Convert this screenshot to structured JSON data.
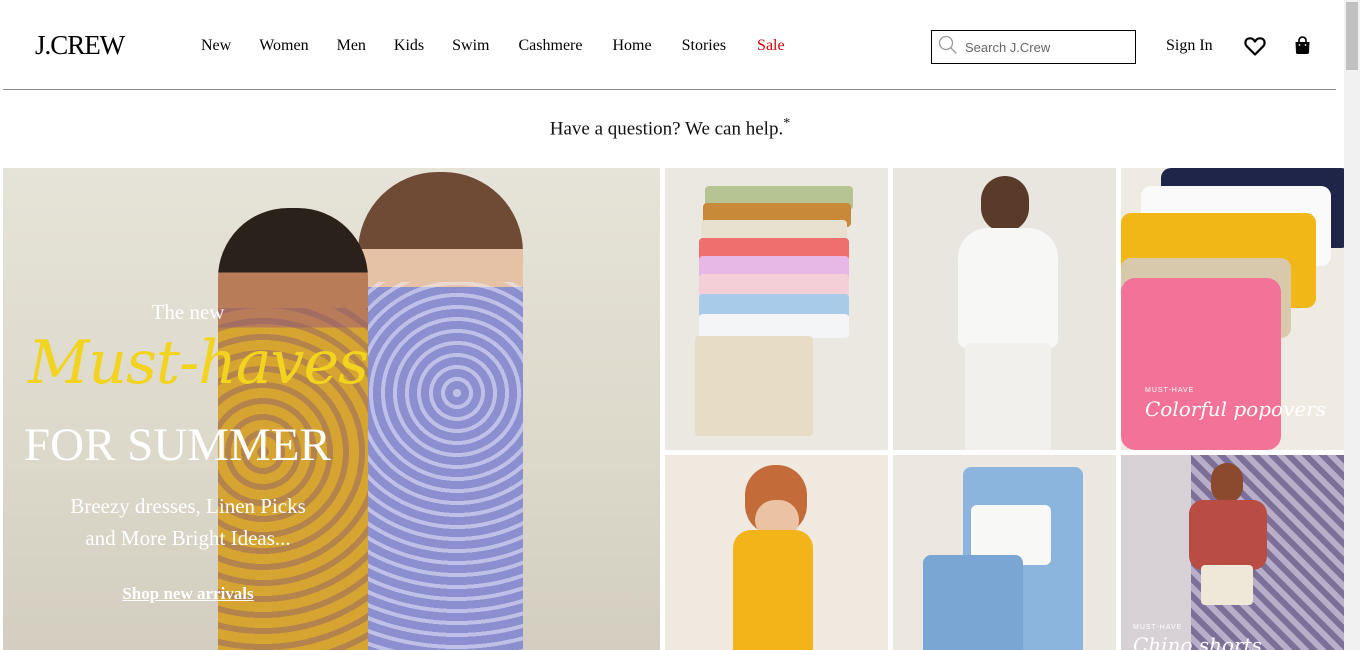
{
  "header": {
    "logo": "J.CREW",
    "nav": [
      {
        "label": "New",
        "color": "#000000"
      },
      {
        "label": "Women",
        "color": "#000000"
      },
      {
        "label": "Men",
        "color": "#000000"
      },
      {
        "label": "Kids",
        "color": "#000000"
      },
      {
        "label": "Swim",
        "color": "#000000"
      },
      {
        "label": "Cashmere",
        "color": "#000000"
      },
      {
        "label": "Home",
        "color": "#000000"
      },
      {
        "label": "Stories",
        "color": "#000000"
      },
      {
        "label": "Sale",
        "color": "#d50000"
      }
    ],
    "search_placeholder": "Search J.Crew",
    "sign_in": "Sign In",
    "icons": [
      "search-icon",
      "heart-icon",
      "bag-icon"
    ]
  },
  "promo": {
    "text": "Have a question? We can help.",
    "mark": "*"
  },
  "hero": {
    "kicker": "The new",
    "script": "Must-haves",
    "title": "FOR SUMMER",
    "subtitle_line1": "Breezy dresses, Linen Picks",
    "subtitle_line2": "and More Bright Ideas...",
    "cta": "Shop new arrivals",
    "script_color": "#f2d31f"
  },
  "tiles": [
    {
      "id": "shorts-stack"
    },
    {
      "id": "white-top"
    },
    {
      "id": "popovers",
      "small": "MUST-HAVE",
      "script": "Colorful popovers"
    },
    {
      "id": "yellow-dress"
    },
    {
      "id": "denim"
    },
    {
      "id": "chino-shorts",
      "small": "MUST-HAVE",
      "script": "Chino shorts"
    }
  ]
}
